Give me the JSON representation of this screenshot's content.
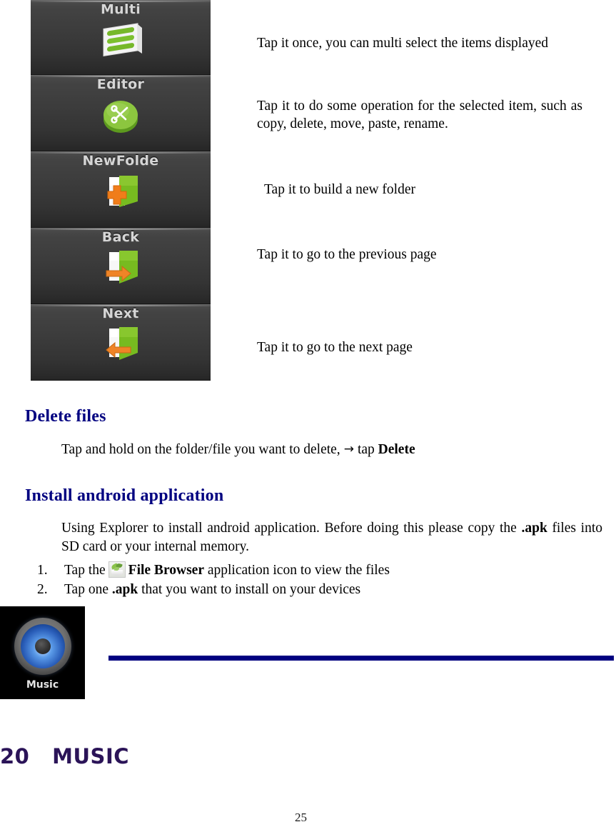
{
  "buttons": [
    {
      "label": "Multi",
      "icon": "multi-select-list-icon"
    },
    {
      "label": "Editor",
      "icon": "scissors-disc-icon"
    },
    {
      "label": "NewFolde",
      "icon": "new-folder-plus-icon"
    },
    {
      "label": "Back",
      "icon": "folder-back-arrow-icon"
    },
    {
      "label": "Next",
      "icon": "folder-next-arrow-icon"
    }
  ],
  "descriptions": {
    "multi": "Tap it once, you can multi select the items displayed",
    "editor": "Tap it to do some operation for the selected item, such as copy, delete, move, paste, rename.",
    "newfolder": "Tap it to build a new folder",
    "back": "Tap it to go to the previous page",
    "next": "Tap it to go to the next page"
  },
  "sections": {
    "delete": {
      "heading": "Delete files",
      "body_before": "Tap and hold on the folder/file you want to delete,",
      "arrow": "→",
      "body_after": "tap",
      "body_bold": "Delete"
    },
    "install": {
      "heading": "Install android application",
      "paragraph_1": "Using Explorer to install android application. Before doing this please copy the",
      "paragraph_1_bold": ".apk",
      "paragraph_2": "files into SD card or your internal memory.",
      "list": [
        {
          "marker": "1.",
          "text_before": "Tap the",
          "icon": "file-browser-app-icon",
          "text_bold": "File Browser",
          "text_after": "application icon to view the files"
        },
        {
          "marker": "2.",
          "text_before": "Tap one",
          "text_bold": ".apk",
          "text_after": "that you want to install on your devices"
        }
      ]
    }
  },
  "music_tile": {
    "label": "Music",
    "icon": "speaker-icon"
  },
  "chapter": {
    "number": "20",
    "title": "MUSIC",
    "full": "20   MUSIC"
  },
  "page_number": "25",
  "colors": {
    "heading_navy": "#000080",
    "chapter_purple": "#2b1458",
    "rule_navy": "#000080",
    "button_dark": "#3b3b3b",
    "icon_green": "#8bc34a",
    "icon_orange": "#f07d1a"
  }
}
